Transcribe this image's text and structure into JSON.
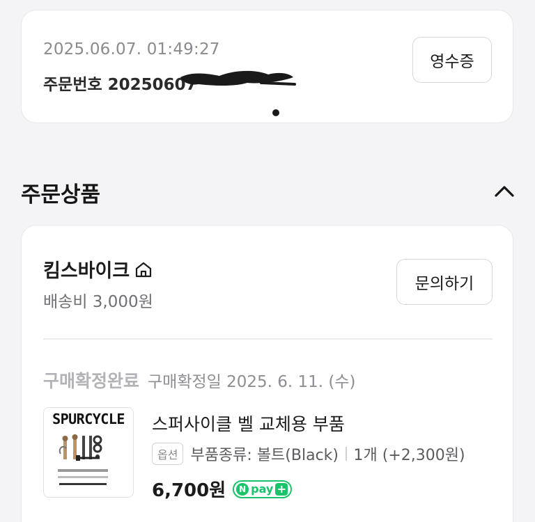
{
  "order": {
    "datetime": "2025.06.07. 01:49:27",
    "number_label": "주문번호",
    "number_visible": "20250607",
    "receipt_button": "영수증"
  },
  "section": {
    "title": "주문상품",
    "collapse_icon": "chevron-up-icon"
  },
  "store": {
    "name": "킴스바이크",
    "icon": "home-icon",
    "shipping": "배송비 3,000원",
    "inquiry_button": "문의하기"
  },
  "status": {
    "label": "구매확정완료",
    "date": "구매확정일 2025. 6. 11. (수)"
  },
  "product": {
    "thumbnail_brand": "SPURCYCLE",
    "name": "스퍼사이클 벨 교체용 부품",
    "option_badge": "옵션",
    "option_text": "부품종류: 볼트(Black)",
    "quantity": "1개 (+2,300원)",
    "price": "6,700원",
    "pay_badge": {
      "n": "N",
      "text": "pay",
      "plus": "+"
    }
  },
  "colors": {
    "background": "#f4f4f6",
    "card": "#ffffff",
    "npay_green": "#19c46a",
    "muted_text": "#8a8a8f"
  }
}
